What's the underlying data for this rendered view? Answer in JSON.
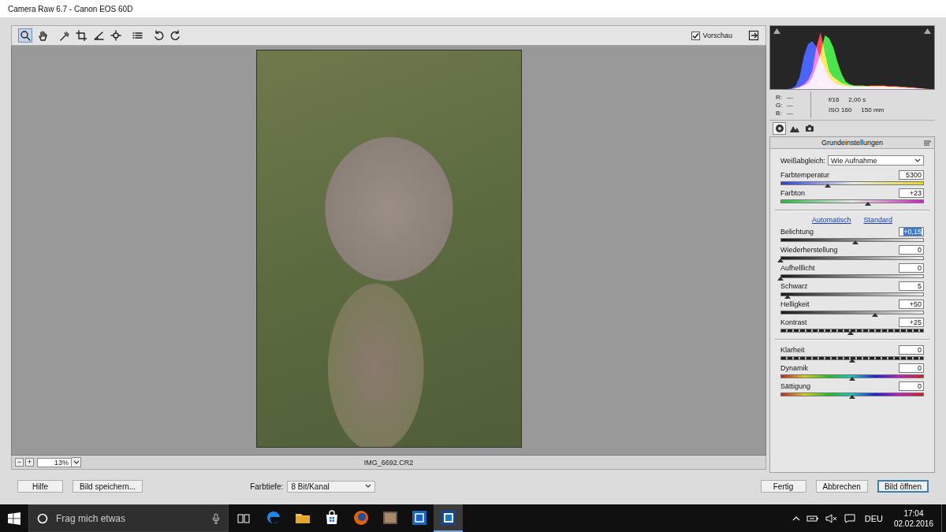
{
  "window": {
    "title": "Camera Raw 6.7 - Canon EOS 60D"
  },
  "toolbar": {
    "tools": [
      {
        "selected": true
      },
      {
        "selected": false
      },
      {
        "selected": false
      },
      {
        "selected": false
      },
      {
        "selected": false
      },
      {
        "selected": false
      },
      {
        "selected": false
      },
      {
        "selected": false
      },
      {
        "selected": false
      }
    ],
    "preview": {
      "label": "Vorschau",
      "checked": true
    }
  },
  "preview": {
    "zoom_out": "−",
    "zoom_in": "+",
    "zoom": "13%",
    "filename": "IMG_6692.CR2"
  },
  "histogram": {
    "series": [
      {
        "color": "#ff2a2a",
        "values": [
          0,
          0,
          0,
          0,
          0,
          0,
          2,
          4,
          8,
          15,
          30,
          70,
          95,
          60,
          30,
          20,
          15,
          10,
          8,
          6,
          5,
          5,
          5,
          5,
          6,
          6,
          6,
          6,
          5,
          5,
          5,
          4,
          4,
          3,
          3,
          2,
          1,
          1,
          0,
          0
        ]
      },
      {
        "color": "#2ae02a",
        "values": [
          0,
          0,
          0,
          0,
          0,
          0,
          1,
          3,
          6,
          10,
          20,
          40,
          60,
          90,
          85,
          70,
          45,
          25,
          12,
          8,
          6,
          6,
          6,
          5,
          5,
          5,
          5,
          5,
          4,
          4,
          4,
          3,
          3,
          2,
          2,
          1,
          1,
          0,
          0,
          0
        ]
      },
      {
        "color": "#2a4aff",
        "values": [
          0,
          0,
          0,
          0,
          0,
          1,
          5,
          20,
          55,
          75,
          80,
          70,
          50,
          35,
          20,
          12,
          8,
          6,
          5,
          5,
          5,
          4,
          4,
          4,
          4,
          4,
          4,
          4,
          3,
          3,
          3,
          3,
          2,
          2,
          2,
          1,
          1,
          0,
          0,
          0
        ]
      }
    ]
  },
  "readout": {
    "rgb": [
      {
        "label": "R:",
        "value": "---"
      },
      {
        "label": "G:",
        "value": "---"
      },
      {
        "label": "B:",
        "value": "---"
      }
    ],
    "aperture": "f/16",
    "shutter": "2,00 s",
    "iso": "ISO 160",
    "focal": "150 mm"
  },
  "panel_tabs": [
    {
      "selected": true
    },
    {
      "selected": false
    },
    {
      "selected": false
    }
  ],
  "panel": {
    "title": "Grundeinstellungen",
    "white_balance": {
      "label": "Weißabgleich:",
      "value": "Wie Aufnahme"
    },
    "color_sliders": [
      {
        "label": "Farbtemperatur",
        "value": "5300",
        "level": 0.33,
        "kind": "temp",
        "focused": false
      },
      {
        "label": "Farbton",
        "value": "+23",
        "level": 0.61,
        "kind": "tint",
        "focused": false
      }
    ],
    "links": [
      "Automatisch",
      "Standard"
    ],
    "tone_sliders": [
      {
        "label": "Belichtung",
        "value": "+0,15",
        "level": 0.52,
        "kind": "tone",
        "focused": true
      },
      {
        "label": "Wiederherstellung",
        "value": "0",
        "level": 0.0,
        "kind": "tone",
        "focused": false
      },
      {
        "label": "Aufhelllicht",
        "value": "0",
        "level": 0.0,
        "kind": "tone",
        "focused": false
      },
      {
        "label": "Schwarz",
        "value": "5",
        "level": 0.05,
        "kind": "tone",
        "focused": false
      },
      {
        "label": "Helligkeit",
        "value": "+50",
        "level": 0.66,
        "kind": "tone",
        "focused": false
      },
      {
        "label": "Kontrast",
        "value": "+25",
        "level": 0.49,
        "kind": "contrast",
        "focused": false
      }
    ],
    "presence_sliders": [
      {
        "label": "Klarheit",
        "value": "0",
        "level": 0.5,
        "kind": "contrast",
        "focused": false
      },
      {
        "label": "Dynamik",
        "value": "0",
        "level": 0.5,
        "kind": "color",
        "focused": false
      },
      {
        "label": "Sättigung",
        "value": "0",
        "level": 0.5,
        "kind": "color",
        "focused": false
      }
    ]
  },
  "bottom": {
    "left_buttons": [
      {
        "label": "Hilfe",
        "default": false
      },
      {
        "label": "Bild speichern...",
        "default": false
      }
    ],
    "depth_label": "Farbtiefe:",
    "depth": "8 Bit/Kanal",
    "right_buttons": [
      {
        "label": "Fertig",
        "default": false
      },
      {
        "label": "Abbrechen",
        "default": false
      },
      {
        "label": "Bild öffnen",
        "default": true
      }
    ]
  },
  "taskbar": {
    "search_placeholder": "Frag mich etwas",
    "apps": [
      {
        "active": false
      },
      {
        "active": false
      },
      {
        "active": false
      },
      {
        "active": false
      },
      {
        "active": false
      },
      {
        "active": false
      },
      {
        "active": true
      }
    ],
    "language": "DEU",
    "time": "17:04",
    "date": "02.02.2016"
  }
}
